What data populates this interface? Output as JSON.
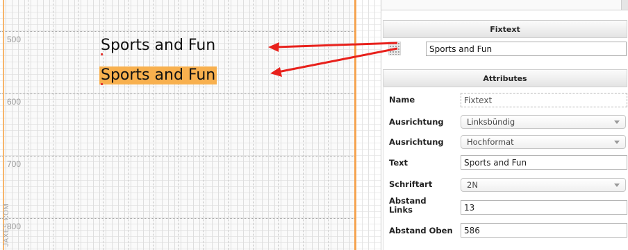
{
  "canvas": {
    "ruler_labels": [
      "500",
      "600",
      "700",
      "800"
    ],
    "text_items": [
      {
        "text": "Sports and Fun",
        "selected": false
      },
      {
        "text": "Sports and Fun",
        "selected": true
      }
    ],
    "watermark": "JAXES.COM"
  },
  "panel": {
    "fixtext_header": "Fixtext",
    "fixtext_value": "Sports and Fun",
    "attributes_header": "Attributes",
    "attributes": {
      "name": {
        "label": "Name",
        "value": "Fixtext"
      },
      "ausrichtung1": {
        "label": "Ausrichtung",
        "value": "Linksbündig"
      },
      "ausrichtung2": {
        "label": "Ausrichtung",
        "value": "Hochformat"
      },
      "text": {
        "label": "Text",
        "value": "Sports and Fun"
      },
      "schriftart": {
        "label": "Schriftart",
        "value": "2N"
      },
      "abstand_links": {
        "label": "Abstand Links",
        "value": "13"
      },
      "abstand_oben": {
        "label": "Abstand Oben",
        "value": "586"
      }
    }
  },
  "colors": {
    "selection_highlight": "#f8b04e",
    "margin_line": "#f5a451",
    "annotation_arrow": "#e8211c"
  },
  "icons": {
    "arrow": "arrow-left-icon",
    "handle": "drag-handle-icon",
    "dropdown": "chevron-down-icon"
  }
}
